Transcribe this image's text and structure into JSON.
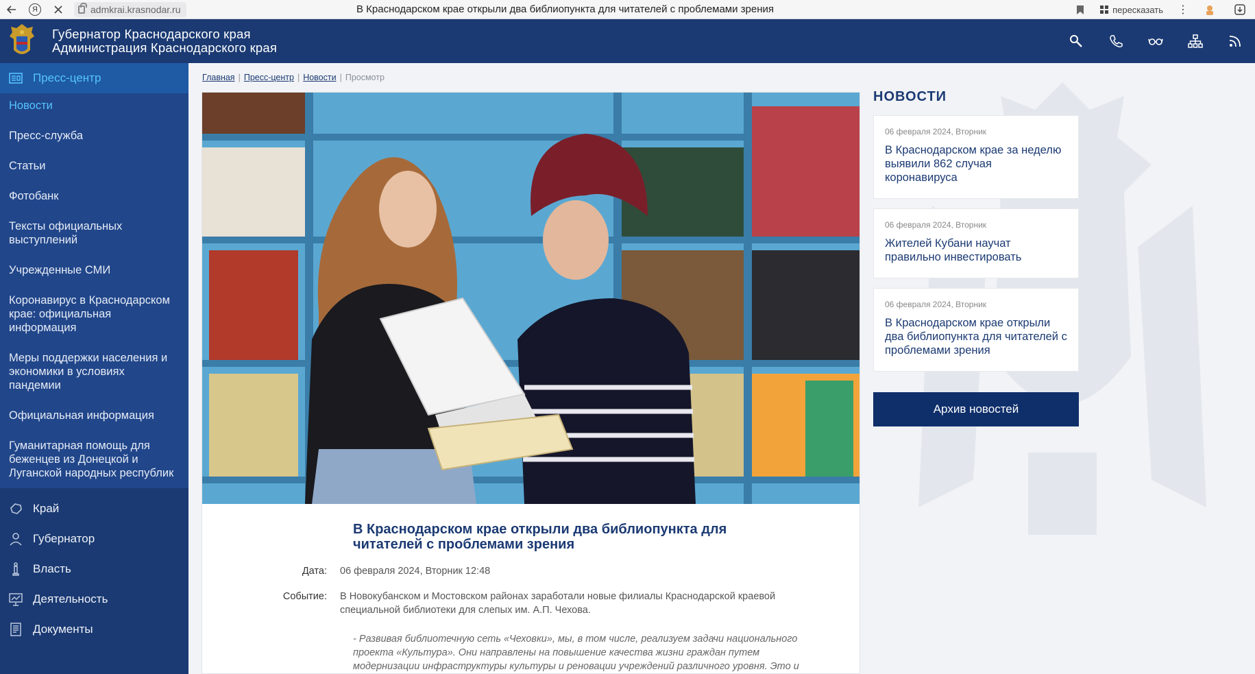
{
  "browser": {
    "url": "admkrai.krasnodar.ru",
    "tab_title": "В Краснодарском крае открыли два библиопункта для читателей с проблемами зрения",
    "yandex_letter": "Я",
    "retell_label": "пересказать"
  },
  "header": {
    "title_line1": "Губернатор Краснодарского края",
    "title_line2": "Администрация Краснодарского края",
    "icons": [
      "search-icon",
      "phone-icon",
      "glasses-icon",
      "sitemap-icon",
      "rss-icon"
    ]
  },
  "sidebar": {
    "active_section": "Пресс-центр",
    "sub_items": [
      "Новости",
      "Пресс-служба",
      "Статьи",
      "Фотобанк",
      "Тексты официальных выступлений",
      "Учрежденные СМИ",
      "Коронавирус в Краснодарском крае: официальная информация",
      "Меры поддержки населения и экономики в условиях пандемии",
      "Официальная информация",
      "Гуманитарная помощь для беженцев из Донецкой и Луганской народных республик"
    ],
    "main_items": [
      {
        "label": "Край",
        "icon": "map-icon"
      },
      {
        "label": "Губернатор",
        "icon": "person-icon"
      },
      {
        "label": "Власть",
        "icon": "pillar-icon"
      },
      {
        "label": "Деятельность",
        "icon": "presentation-icon"
      },
      {
        "label": "Документы",
        "icon": "document-icon"
      }
    ]
  },
  "breadcrumb": {
    "items": [
      "Главная",
      "Пресс-центр",
      "Новости"
    ],
    "current": "Просмотр",
    "separator": "|"
  },
  "article": {
    "title": "В Краснодарском крае открыли два библиопункта для читателей с проблемами зрения",
    "date_label": "Дата:",
    "date_value": "06 февраля 2024, Вторник 12:48",
    "event_label": "Событие:",
    "event_value": "В Новокубанском и Мостовском районах заработали новые филиалы Краснодарской краевой специальной библиотеки для слепых им. А.П. Чехова.",
    "quote": "- Развивая библиотечную сеть «Чеховки», мы, в том числе, реализуем задачи национального проекта «Культура». Они направлены на повышение качества жизни граждан путем модернизации инфраструктуры культуры и реновации учреждений различного уровня. Это и"
  },
  "news": {
    "heading": "НОВОСТИ",
    "items": [
      {
        "date": "06 февраля 2024, Вторник",
        "title": "В Краснодарском крае за неделю выявили 862 случая коронавируса"
      },
      {
        "date": "06 февраля 2024, Вторник",
        "title": "Жителей Кубани научат правильно инвестировать"
      },
      {
        "date": "06 февраля 2024, Вторник",
        "title": "В Краснодарском крае открыли два библиопункта для читателей с проблемами зрения"
      }
    ],
    "archive_label": "Архив новостей"
  },
  "colors": {
    "primary": "#1b3a73",
    "accent": "#55c4ff",
    "sidebar_active": "#1f5aa5"
  }
}
